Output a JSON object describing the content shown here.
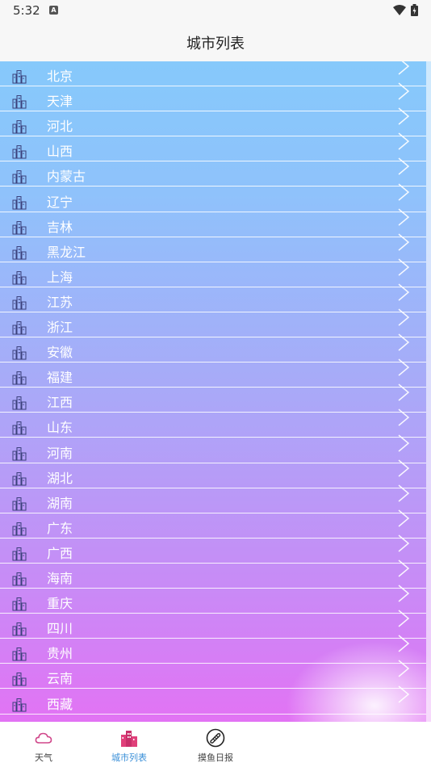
{
  "status": {
    "time": "5:32",
    "app_icon_letter": "A"
  },
  "header": {
    "title": "城市列表"
  },
  "cities": [
    "北京",
    "天津",
    "河北",
    "山西",
    "内蒙古",
    "辽宁",
    "吉林",
    "黑龙江",
    "上海",
    "江苏",
    "浙江",
    "安徽",
    "福建",
    "江西",
    "山东",
    "河南",
    "湖北",
    "湖南",
    "广东",
    "广西",
    "海南",
    "重庆",
    "四川",
    "贵州",
    "云南",
    "西藏"
  ],
  "nav": {
    "items": [
      {
        "label": "天气",
        "icon": "cloud-icon"
      },
      {
        "label": "城市列表",
        "icon": "city-buildings-icon",
        "active": true
      },
      {
        "label": "摸鱼日报",
        "icon": "fish-report-icon"
      }
    ]
  },
  "colors": {
    "list_gradient_top": "#86c9fb",
    "list_gradient_bottom": "#e273f4",
    "nav_active": "#3a8fd8",
    "city_icon_pink": "#e0407a"
  }
}
